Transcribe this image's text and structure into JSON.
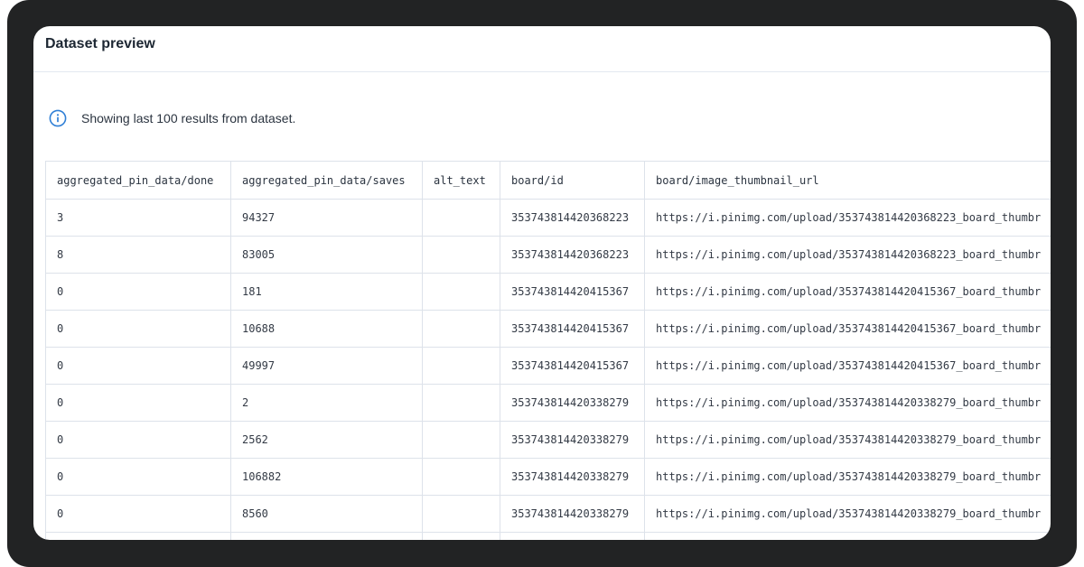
{
  "card": {
    "title": "Dataset preview"
  },
  "info": {
    "icon": "info-icon",
    "text": "Showing last 100 results from dataset."
  },
  "table": {
    "columns": [
      "aggregated_pin_data/done",
      "aggregated_pin_data/saves",
      "alt_text",
      "board/id",
      "board/image_thumbnail_url"
    ],
    "rows": [
      [
        "3",
        "94327",
        "",
        "353743814420368223",
        "https://i.pinimg.com/upload/353743814420368223_board_thumbr"
      ],
      [
        "8",
        "83005",
        "",
        "353743814420368223",
        "https://i.pinimg.com/upload/353743814420368223_board_thumbr"
      ],
      [
        "0",
        "181",
        "",
        "353743814420415367",
        "https://i.pinimg.com/upload/353743814420415367_board_thumbr"
      ],
      [
        "0",
        "10688",
        "",
        "353743814420415367",
        "https://i.pinimg.com/upload/353743814420415367_board_thumbr"
      ],
      [
        "0",
        "49997",
        "",
        "353743814420415367",
        "https://i.pinimg.com/upload/353743814420415367_board_thumbr"
      ],
      [
        "0",
        "2",
        "",
        "353743814420338279",
        "https://i.pinimg.com/upload/353743814420338279_board_thumbr"
      ],
      [
        "0",
        "2562",
        "",
        "353743814420338279",
        "https://i.pinimg.com/upload/353743814420338279_board_thumbr"
      ],
      [
        "0",
        "106882",
        "",
        "353743814420338279",
        "https://i.pinimg.com/upload/353743814420338279_board_thumbr"
      ],
      [
        "0",
        "8560",
        "",
        "353743814420338279",
        "https://i.pinimg.com/upload/353743814420338279_board_thumbr"
      ],
      [
        "",
        "",
        "",
        "",
        ""
      ]
    ]
  },
  "colors": {
    "frame": "#222324",
    "info_accent": "#2f7fd6",
    "border": "#dde2ea"
  }
}
